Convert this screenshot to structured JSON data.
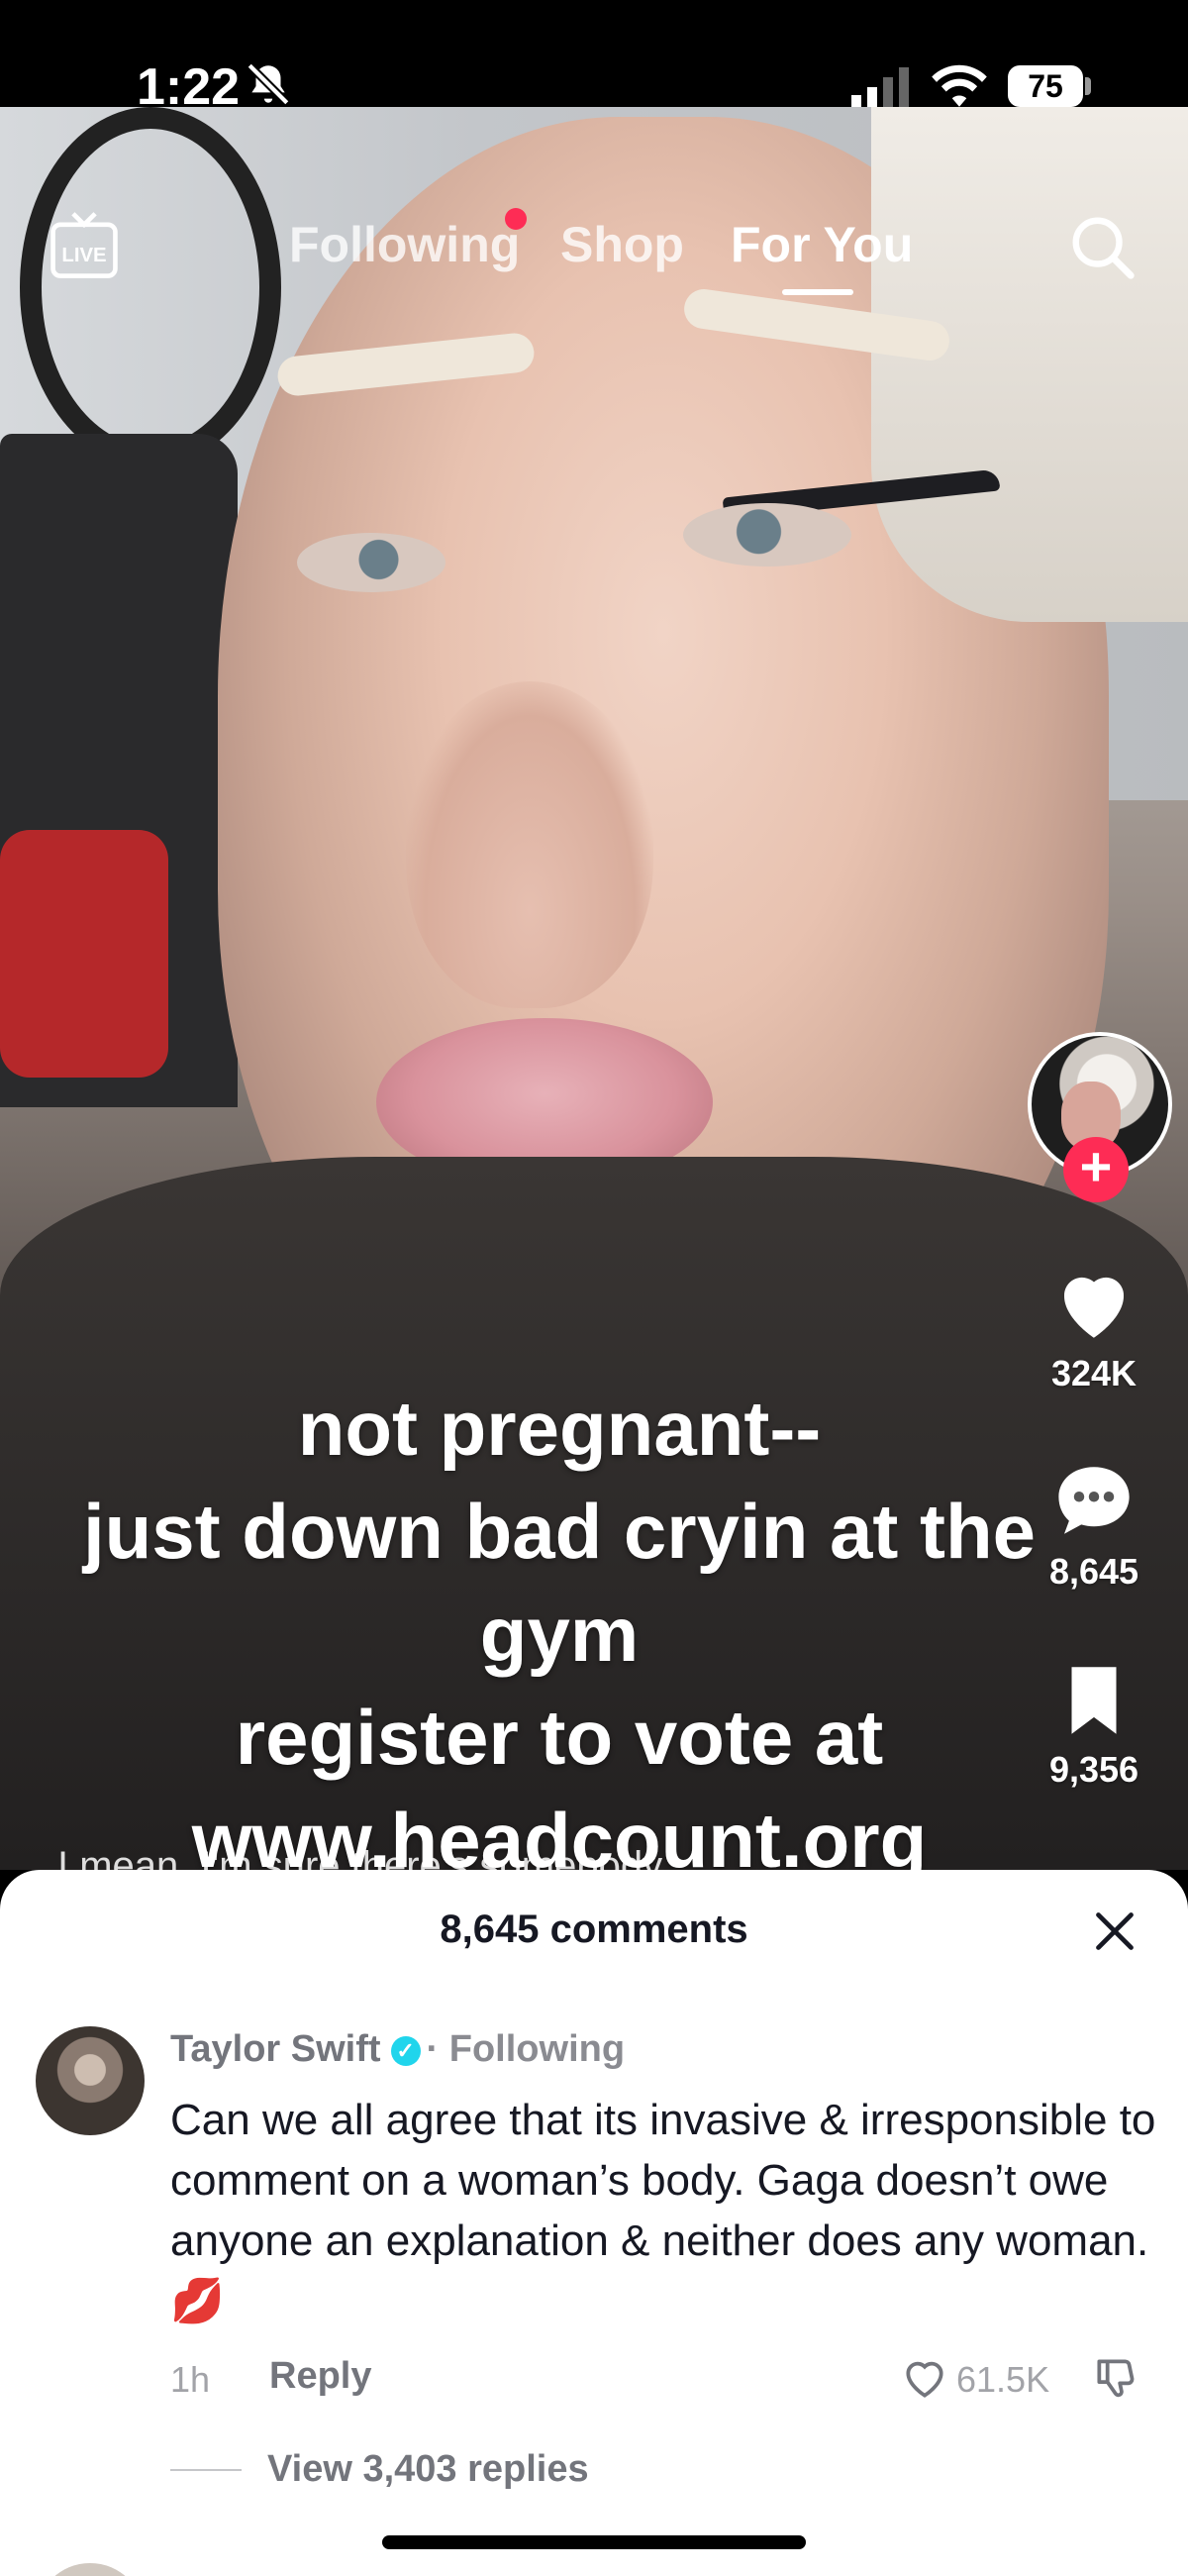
{
  "status_bar": {
    "time": "1:22",
    "battery": "75",
    "icons": [
      "bell-muted-icon",
      "signal-icon",
      "wifi-icon",
      "battery-icon"
    ]
  },
  "top_nav": {
    "live_label": "LIVE",
    "tabs": [
      {
        "label": "Following",
        "has_dot": true
      },
      {
        "label": "Shop"
      },
      {
        "label": "For You",
        "active": true
      }
    ]
  },
  "video": {
    "caption_lines": [
      "not pregnant--",
      "just down bad cryin at the",
      "gym",
      "register to vote at",
      "www.headcount.org"
    ],
    "behind_caption": "I mean, I'm sure there's somebody..."
  },
  "rail": {
    "likes": "324K",
    "comments": "8,645",
    "saves": "9,356"
  },
  "comments_sheet": {
    "title": "8,645 comments",
    "comment": {
      "username": "Taylor Swift",
      "relation": "· Following",
      "text": "Can we all agree that its invasive & irresponsible to comment on a woman’s body. Gaga doesn’t owe anyone an explanation & neither does any woman. 💋",
      "time": "1h",
      "reply_label": "Reply",
      "like_count": "61.5K",
      "view_replies": "View 3,403 replies"
    }
  },
  "colors": {
    "accent": "#fe2c55",
    "verified": "#20d5ec",
    "text_primary": "#161823",
    "text_muted": "#73757c"
  }
}
